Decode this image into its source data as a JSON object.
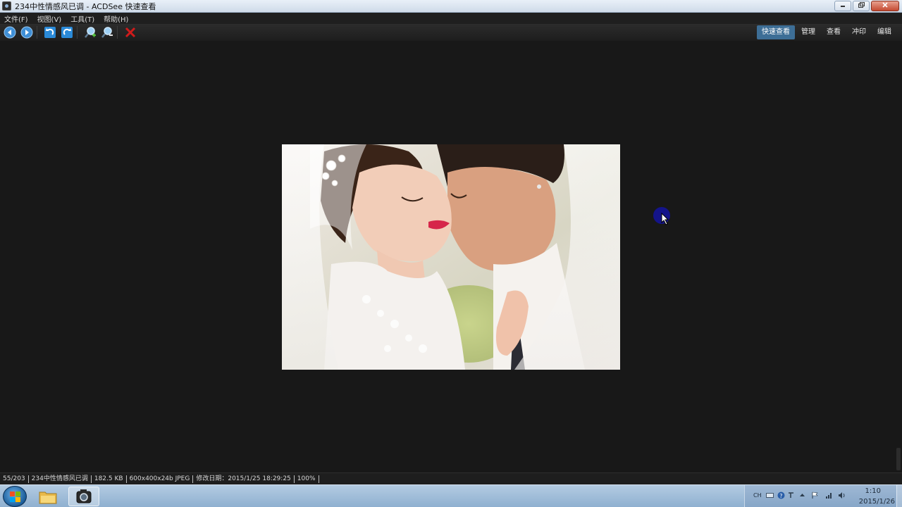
{
  "window": {
    "title": "234中性情感风已调 - ACDSee 快速查看",
    "controls": [
      "minimize-icon",
      "maximize-icon",
      "close-icon"
    ]
  },
  "menu": {
    "items": [
      {
        "label": "文件(F)"
      },
      {
        "label": "视图(V)"
      },
      {
        "label": "工具(T)"
      },
      {
        "label": "帮助(H)"
      }
    ]
  },
  "toolbar": {
    "buttons": [
      "previous-icon",
      "next-icon",
      "rotate-left-icon",
      "rotate-right-icon",
      "zoom-in-icon",
      "zoom-out-icon",
      "delete-icon"
    ],
    "modes": [
      {
        "label": "快速查看",
        "active": true
      },
      {
        "label": "管理"
      },
      {
        "label": "查看"
      },
      {
        "label": "冲印"
      },
      {
        "label": "编辑"
      }
    ]
  },
  "viewer": {
    "image_description": "wedding photo: bride in lace dress with veil, groom kissing her cheek"
  },
  "status": {
    "index": "55/203",
    "filename": "234中性情感风已调",
    "filesize": "182.5 KB",
    "dimensions": "600x400x24b JPEG",
    "modified": "修改日期：2015/1/25 18:29:25",
    "zoom": "100%"
  },
  "taskbar": {
    "apps": [
      "windows-explorer-icon",
      "acdsee-icon"
    ],
    "tray_lang": "CH",
    "time": "1:10",
    "date": "2015/1/26"
  },
  "colors": {
    "background": "#181818",
    "active_mode_tab": "#3d6e96",
    "taskbar": "#a6c1dc"
  }
}
